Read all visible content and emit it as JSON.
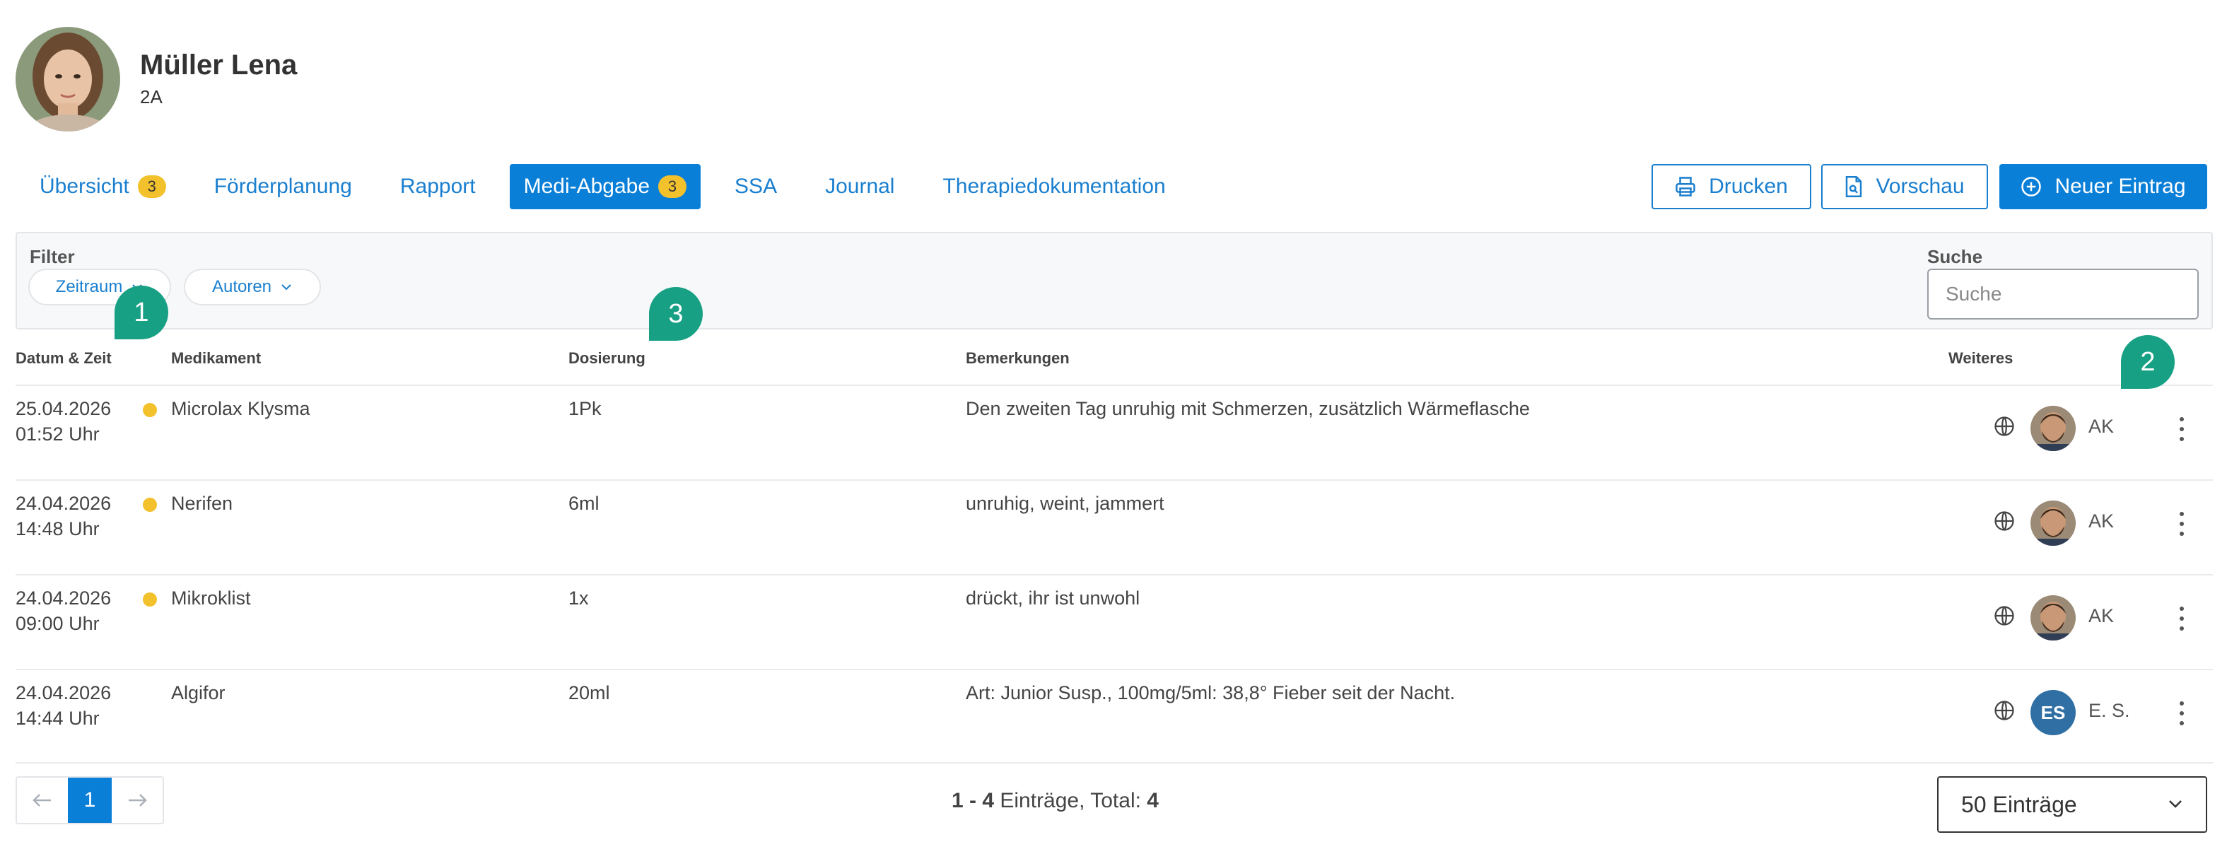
{
  "header": {
    "name": "Müller Lena",
    "class": "2A"
  },
  "tabs": [
    {
      "label": "Übersicht",
      "badge": "3",
      "active": false
    },
    {
      "label": "Förderplanung",
      "active": false
    },
    {
      "label": "Rapport",
      "active": false
    },
    {
      "label": "Medi-Abgabe",
      "badge": "3",
      "active": true
    },
    {
      "label": "SSA",
      "active": false
    },
    {
      "label": "Journal",
      "active": false
    },
    {
      "label": "Therapiedokumentation",
      "active": false
    }
  ],
  "actions": {
    "print": "Drucken",
    "preview": "Vorschau",
    "new_entry": "Neuer Eintrag"
  },
  "filter": {
    "label": "Filter",
    "period": "Zeitraum",
    "authors": "Autoren",
    "search_label": "Suche",
    "search_placeholder": "Suche"
  },
  "table": {
    "headers": {
      "datetime": "Datum & Zeit",
      "medication": "Medikament",
      "dosage": "Dosierung",
      "remarks": "Bemerkungen",
      "more": "Weiteres"
    },
    "rows": [
      {
        "date": "25.04.2026",
        "time": "01:52 Uhr",
        "dot": true,
        "medication": "Microlax Klysma",
        "dosage": "1Pk",
        "remarks": "Den zweiten Tag unruhig mit Schmerzen, zusätzlich Wärmeflasche",
        "author": "AK",
        "avatar_type": "photo"
      },
      {
        "date": "24.04.2026",
        "time": "14:48 Uhr",
        "dot": true,
        "medication": "Nerifen",
        "dosage": "6ml",
        "remarks": "unruhig, weint, jammert",
        "author": "AK",
        "avatar_type": "photo"
      },
      {
        "date": "24.04.2026",
        "time": "09:00 Uhr",
        "dot": true,
        "medication": "Mikroklist",
        "dosage": "1x",
        "remarks": "drückt, ihr ist unwohl",
        "author": "AK",
        "avatar_type": "photo"
      },
      {
        "date": "24.04.2026",
        "time": "14:44 Uhr",
        "dot": false,
        "medication": "Algifor",
        "dosage": "20ml",
        "remarks": "Art: Junior Susp., 100mg/5ml: 38,8° Fieber seit der Nacht.",
        "author": "E. S.",
        "avatar_type": "initials",
        "initials": "ES"
      }
    ]
  },
  "pagination": {
    "prev_icon": "arrow-left-icon",
    "current": "1",
    "next_icon": "arrow-right-icon",
    "range": "1 - 4",
    "entries_text": "Einträge, Total:",
    "total": "4",
    "per_page": "50 Einträge"
  },
  "markers": [
    "1",
    "2",
    "3"
  ],
  "colors": {
    "primary": "#0a7fd8",
    "badge": "#f3c12c",
    "marker": "#18a085",
    "initials_avatar": "#2f6fa3"
  }
}
